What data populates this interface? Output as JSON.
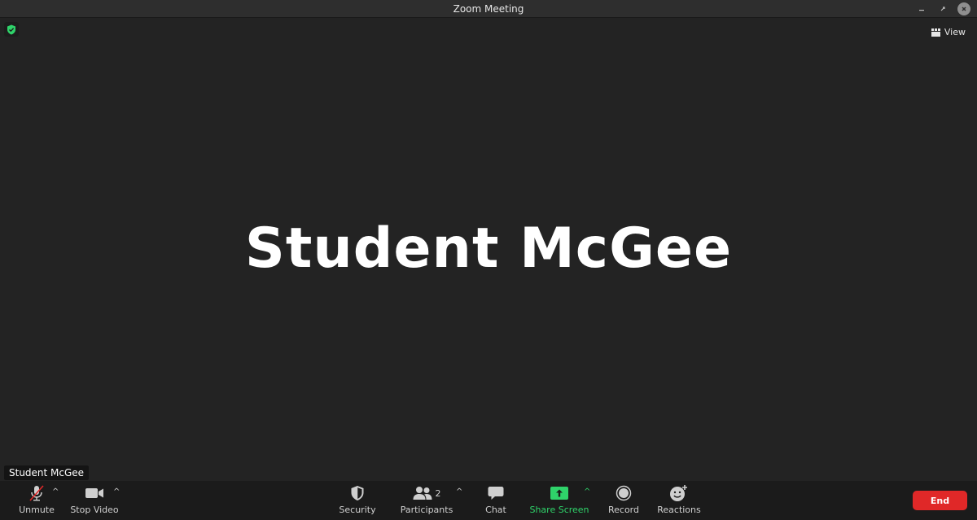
{
  "window": {
    "title": "Zoom Meeting",
    "controls": [
      "minimize",
      "restore",
      "close"
    ]
  },
  "top_right": {
    "view_label": "View",
    "view_icon": "grid-icon"
  },
  "security_indicator": {
    "icon": "shield-check-icon",
    "color": "#2fd36a"
  },
  "main": {
    "participant_name": "Student McGee"
  },
  "name_tag": {
    "label": "Student McGee"
  },
  "toolbar": {
    "unmute_label": "Unmute",
    "stop_video_label": "Stop Video",
    "security_label": "Security",
    "participants_label": "Participants",
    "participants_count": "2",
    "chat_label": "Chat",
    "share_screen_label": "Share Screen",
    "record_label": "Record",
    "reactions_label": "Reactions",
    "end_label": "End"
  },
  "colors": {
    "background": "#232323",
    "toolbar": "#1b1b1b",
    "accent_green": "#2fd36a",
    "end_red": "#e02828",
    "mute_slash": "#e02828"
  }
}
